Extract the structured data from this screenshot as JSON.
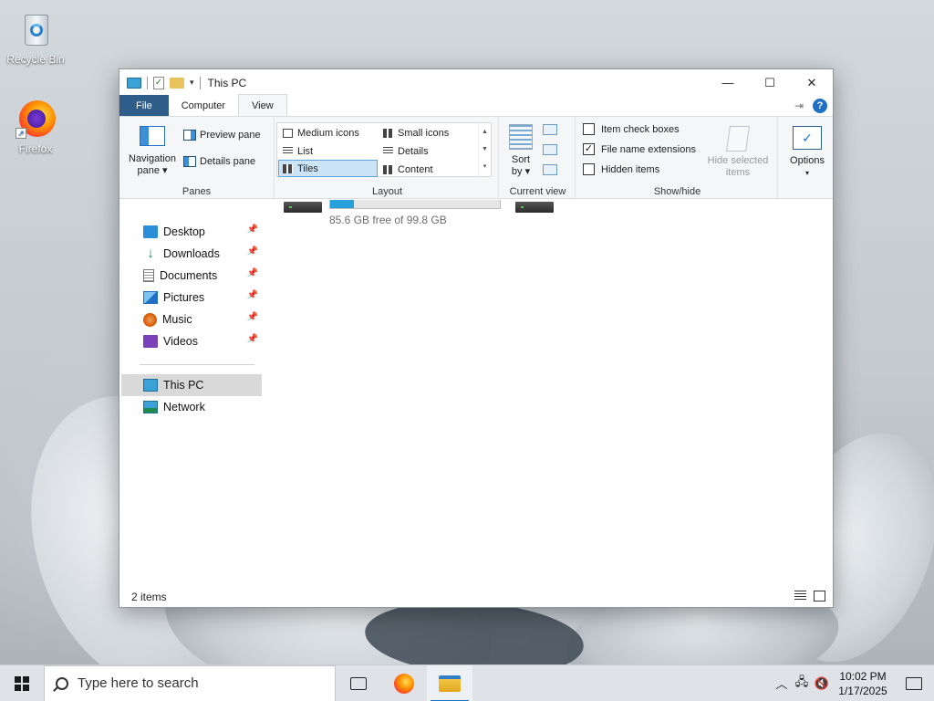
{
  "desktop": {
    "icons": [
      {
        "label": "Recycle Bin"
      },
      {
        "label": "Firefox"
      }
    ]
  },
  "window": {
    "title": "This PC",
    "controls": {
      "minimize": "—",
      "maximize": "☐",
      "close": "✕"
    },
    "tabs": [
      {
        "label": "File"
      },
      {
        "label": "Computer"
      },
      {
        "label": "View"
      }
    ],
    "help": "?",
    "ribbon": {
      "panes": {
        "group_label": "Panes",
        "navigation_pane": "Navigation pane ▾",
        "preview_pane": "Preview pane",
        "details_pane": "Details pane"
      },
      "layout": {
        "group_label": "Layout",
        "items": [
          "Medium icons",
          "Small icons",
          "List",
          "Details",
          "Tiles",
          "Content"
        ],
        "selected": "Tiles"
      },
      "current_view": {
        "group_label": "Current view",
        "sort_by": "Sort by ▾"
      },
      "show_hide": {
        "group_label": "Show/hide",
        "item_check_boxes": "Item check boxes",
        "item_check_boxes_checked": false,
        "file_name_extensions": "File name extensions",
        "file_name_extensions_checked": true,
        "hidden_items": "Hidden items",
        "hidden_items_checked": false,
        "hide_selected_items": "Hide selected items"
      },
      "options": {
        "label": "Options"
      }
    },
    "nav": {
      "quick_access": [
        {
          "label": "Desktop"
        },
        {
          "label": "Downloads"
        },
        {
          "label": "Documents"
        },
        {
          "label": "Pictures"
        },
        {
          "label": "Music"
        },
        {
          "label": "Videos"
        }
      ],
      "this_pc": "This PC",
      "network": "Network"
    },
    "content": {
      "drive_free": "85.6 GB free of 99.8 GB",
      "drive_used_fraction": 0.142
    },
    "status": {
      "items": "2 items"
    }
  },
  "taskbar": {
    "search_placeholder": "Type here to search",
    "time": "10:02 PM",
    "date": "1/17/2025"
  }
}
